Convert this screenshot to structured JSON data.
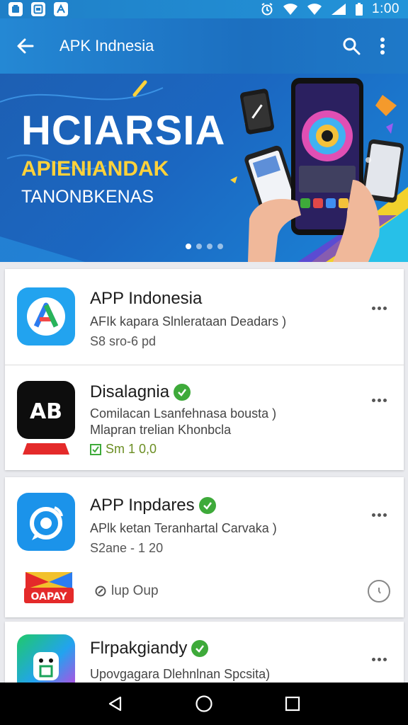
{
  "status_bar": {
    "time": "1:00",
    "left_icons": [
      "app-notification-icon",
      "gallery-icon",
      "a-app-icon"
    ],
    "right_icons": [
      "alarm-icon",
      "wifi-icon",
      "wifi-icon",
      "signal-icon",
      "battery-icon"
    ]
  },
  "app_bar": {
    "title": "APK Indnesia",
    "back_icon": "arrow-left-icon",
    "search_icon": "search-icon",
    "menu_icon": "more-vertical-icon"
  },
  "banner": {
    "headline": "HCIARSIA",
    "subline1": "APIENIANDAK",
    "subline2": "TANONBKENAS",
    "dots": 4,
    "active_dot": 1
  },
  "apps": [
    {
      "name": "APP Indonesia",
      "description": "AFIk kapara Slnlerataan Deadars )",
      "meta": "S8 sro-6 pd",
      "verified": false
    },
    {
      "name": "Disalagnia",
      "description": "Comilacan Lsanfehnasa bousta )",
      "description2": "Mlapran trelian Khonbcla",
      "meta": "Sm 1 0,0",
      "verified": true
    },
    {
      "name": "APP Inpdares",
      "description": "APlk ketan Teranhartal Carvaka )",
      "meta": "S2ane - 1 20",
      "verified": true,
      "sub_label": "lup Oup"
    },
    {
      "name": "Flrpakgiandy",
      "description": "Upovgagara Dlehnlnan Spcsita)",
      "verified": true
    }
  ],
  "icons": {
    "card_more": "more-horizontal-icon",
    "nav_back": "triangle-back-icon",
    "nav_home": "circle-home-icon",
    "nav_recent": "square-recent-icon"
  },
  "colors": {
    "primary": "#1f7fc7",
    "accent_yellow": "#ffd23a",
    "verified_green": "#3eaa3a"
  }
}
